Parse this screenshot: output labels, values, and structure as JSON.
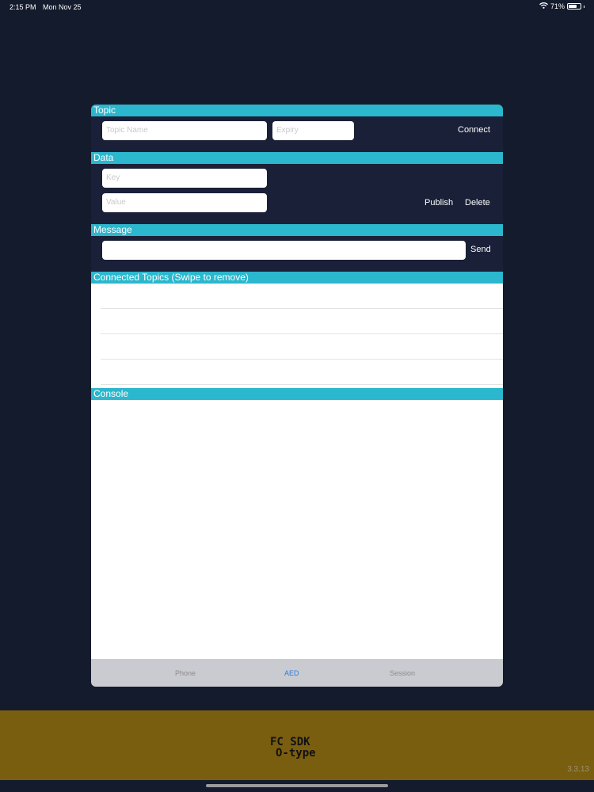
{
  "status_bar": {
    "time": "2:15 PM",
    "date": "Mon Nov 25",
    "battery_text": "71%",
    "battery_level": 0.71
  },
  "sections": {
    "topic": "Topic",
    "data": "Data",
    "message": "Message",
    "connected_topics": "Connected Topics (Swipe to remove)",
    "console": "Console"
  },
  "topic": {
    "name_placeholder": "Topic Name",
    "expiry_placeholder": "Expiry",
    "connect_label": "Connect"
  },
  "data": {
    "key_placeholder": "Key",
    "value_placeholder": "Value",
    "publish_label": "Publish",
    "delete_label": "Delete"
  },
  "message": {
    "value": "",
    "send_label": "Send"
  },
  "connected_topics": [],
  "console_text": "",
  "tabs": [
    {
      "label": "Phone",
      "active": false
    },
    {
      "label": "AED",
      "active": true
    },
    {
      "label": "Session",
      "active": false
    }
  ],
  "brand": {
    "logo_line1": "FC SDK",
    "logo_line2": "O-type",
    "version": "3.3.13"
  },
  "colors": {
    "background": "#141b2d",
    "section_header": "#2bb7cd",
    "brand_bar": "#7a5e10",
    "active_tab": "#2c7be5"
  }
}
